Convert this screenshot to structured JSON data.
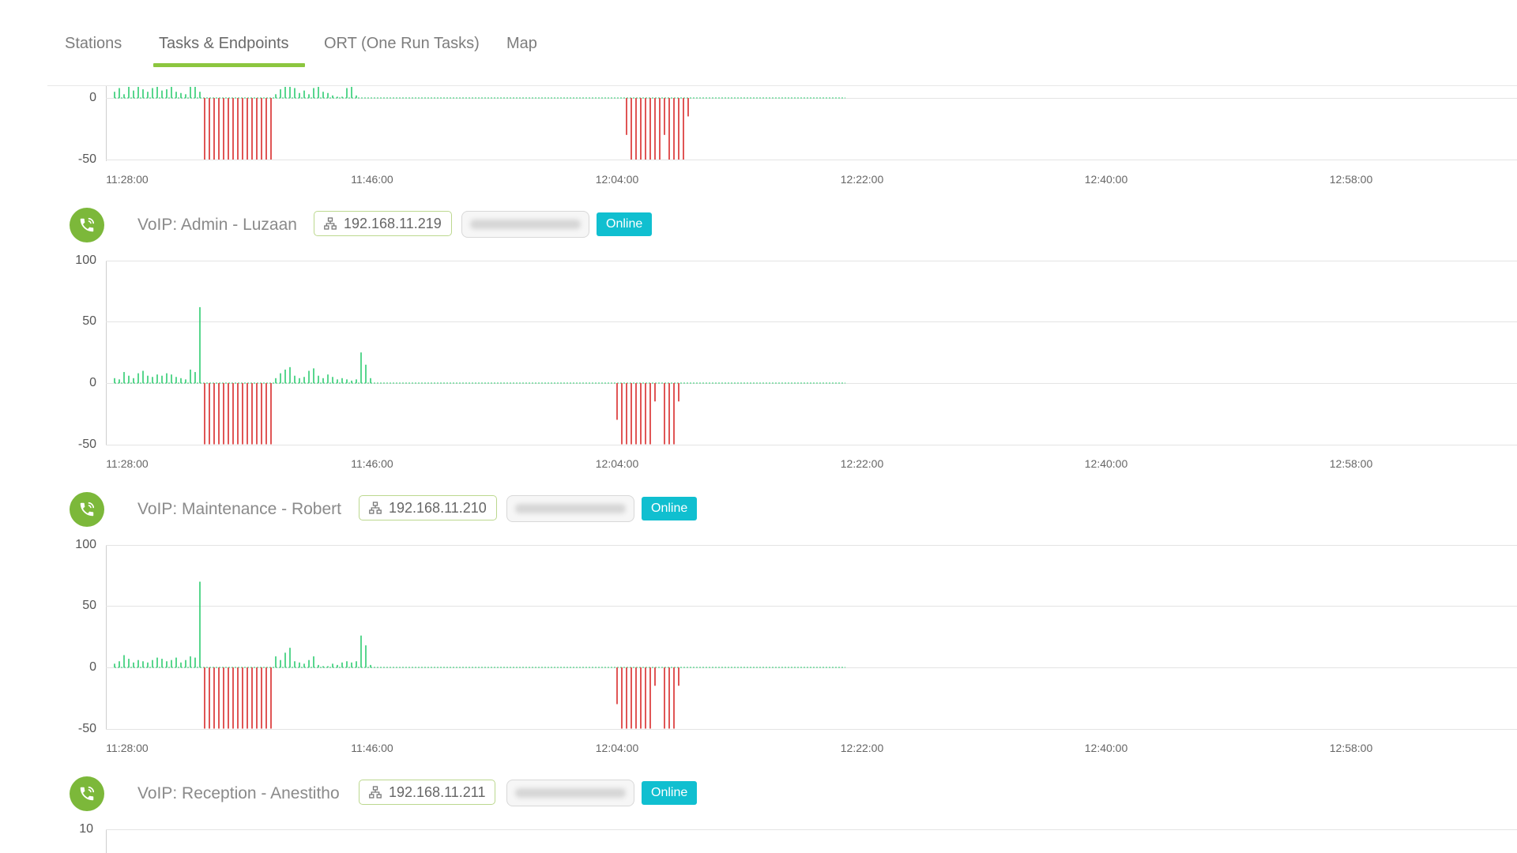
{
  "tabs": [
    {
      "label": "Stations",
      "active": false
    },
    {
      "label": "Tasks & Endpoints",
      "active": true
    },
    {
      "label": "ORT (One Run Tasks)",
      "active": false
    },
    {
      "label": "Map",
      "active": false
    }
  ],
  "colors": {
    "accent": "#8cc63f",
    "positive_bar": "#2ecc71",
    "negative_bar": "#e05555",
    "status_online": "#10bfd0",
    "icon_bg": "#7cb83a"
  },
  "x_ticks": [
    "11:28:00",
    "11:46:00",
    "12:04:00",
    "12:22:00",
    "12:40:00",
    "12:58:00"
  ],
  "endpoints": [
    {
      "name": "VoIP: Admin - Luzaan",
      "ip": "192.168.11.219",
      "status": "Online",
      "icon": "phone-icon"
    },
    {
      "name": "VoIP: Maintenance - Robert",
      "ip": "192.168.11.210",
      "status": "Online",
      "icon": "phone-icon"
    },
    {
      "name": "VoIP: Reception - Anestitho",
      "ip": "192.168.11.211",
      "status": "Online",
      "icon": "phone-icon"
    }
  ],
  "charts": [
    {
      "y_ticks": [
        "0",
        "-50"
      ]
    },
    {
      "y_ticks": [
        "100",
        "50",
        "0",
        "-50"
      ]
    },
    {
      "y_ticks": [
        "100",
        "50",
        "0",
        "-50"
      ]
    },
    {
      "y_ticks": [
        "10"
      ]
    }
  ],
  "chart_data": [
    {
      "type": "bar",
      "partial": true,
      "x_range": [
        "11:28:00",
        "12:58:00"
      ],
      "ylim": [
        -50,
        0
      ],
      "series": [
        {
          "values": [
            5,
            8,
            3,
            9,
            6,
            12,
            7,
            5,
            8,
            11,
            6,
            7,
            9,
            5,
            4,
            3,
            10,
            12,
            5,
            -50,
            -50,
            -50,
            -50,
            -50,
            -50,
            -50,
            -50,
            -50,
            -50,
            -50,
            -50,
            -50,
            -50,
            -50,
            3,
            7,
            9,
            11,
            8,
            4,
            6,
            3,
            8,
            9,
            5,
            4,
            2,
            1,
            1,
            8,
            10,
            2,
            0,
            0,
            0,
            0,
            0,
            0,
            0,
            0,
            0,
            0,
            0,
            0,
            0,
            0,
            0,
            0,
            0,
            0,
            0,
            0,
            0,
            0,
            0,
            0,
            0,
            0,
            0,
            0,
            0,
            0,
            0,
            0,
            0,
            0,
            0,
            0,
            0,
            0,
            0,
            0,
            0,
            0,
            0,
            0,
            0,
            0,
            0,
            0,
            0,
            0,
            0,
            0,
            0,
            0,
            0,
            0,
            -30,
            -50,
            -50,
            -50,
            -50,
            -50,
            -50,
            -50,
            -30,
            -50,
            -50,
            -50,
            -50,
            -15
          ]
        }
      ]
    },
    {
      "type": "bar",
      "x_range": [
        "11:28:00",
        "12:58:00"
      ],
      "ylim": [
        -50,
        100
      ],
      "series": [
        {
          "values": [
            4,
            3,
            9,
            6,
            4,
            8,
            10,
            6,
            5,
            7,
            6,
            8,
            7,
            5,
            4,
            3,
            11,
            9,
            62,
            -50,
            -50,
            -50,
            -50,
            -50,
            -50,
            -50,
            -50,
            -50,
            -50,
            -50,
            -50,
            -50,
            -50,
            -50,
            4,
            8,
            11,
            13,
            6,
            4,
            5,
            10,
            12,
            6,
            4,
            7,
            5,
            3,
            4,
            3,
            2,
            3,
            25,
            15,
            4,
            0,
            0,
            0,
            0,
            0,
            0,
            0,
            0,
            0,
            0,
            0,
            0,
            0,
            0,
            0,
            0,
            0,
            0,
            0,
            0,
            0,
            0,
            0,
            0,
            0,
            0,
            0,
            0,
            0,
            0,
            0,
            0,
            0,
            0,
            0,
            0,
            0,
            0,
            0,
            0,
            0,
            0,
            0,
            0,
            0,
            0,
            0,
            0,
            0,
            0,
            0,
            -30,
            -50,
            -50,
            -50,
            -50,
            -50,
            -50,
            -50,
            -15,
            0,
            -50,
            -50,
            -50,
            -15
          ]
        }
      ]
    },
    {
      "type": "bar",
      "x_range": [
        "11:28:00",
        "12:58:00"
      ],
      "ylim": [
        -50,
        100
      ],
      "series": [
        {
          "values": [
            3,
            5,
            10,
            7,
            4,
            6,
            5,
            4,
            6,
            8,
            7,
            5,
            6,
            8,
            4,
            6,
            9,
            8,
            70,
            -50,
            -50,
            -50,
            -50,
            -50,
            -50,
            -50,
            -50,
            -50,
            -50,
            -50,
            -50,
            -50,
            -50,
            -50,
            9,
            6,
            12,
            16,
            5,
            4,
            3,
            6,
            9,
            2,
            1,
            1,
            3,
            2,
            4,
            5,
            4,
            5,
            26,
            18,
            2,
            0,
            0,
            0,
            0,
            0,
            0,
            0,
            0,
            0,
            0,
            0,
            0,
            0,
            0,
            0,
            0,
            0,
            0,
            0,
            0,
            0,
            0,
            0,
            0,
            0,
            0,
            0,
            0,
            0,
            0,
            0,
            0,
            0,
            0,
            0,
            0,
            0,
            0,
            0,
            0,
            0,
            0,
            0,
            0,
            0,
            0,
            0,
            0,
            0,
            0,
            0,
            -30,
            -50,
            -50,
            -50,
            -50,
            -50,
            -50,
            -50,
            -15,
            0,
            -50,
            -50,
            -50,
            -15
          ]
        }
      ]
    }
  ]
}
